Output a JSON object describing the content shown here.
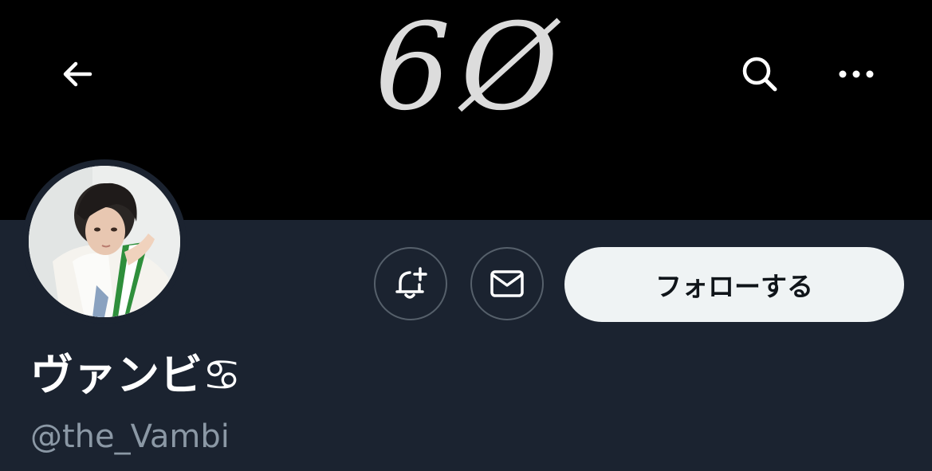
{
  "header": {
    "banner_text": "6Ø",
    "back_icon": "arrow-left-icon",
    "search_icon": "search-icon",
    "more_icon": "more-horizontal-icon"
  },
  "profile": {
    "display_name": "ヴァンビ♋",
    "handle": "@the_Vambi",
    "avatar_icon": "avatar",
    "actions": {
      "notify_icon": "bell-plus-icon",
      "message_icon": "envelope-icon",
      "follow_label": "フォローする"
    }
  },
  "colors": {
    "banner_bg": "#000000",
    "profile_bg": "#1b2330",
    "follow_bg": "#eff3f4",
    "handle_text": "#8b98a5",
    "button_border": "#56606b"
  }
}
